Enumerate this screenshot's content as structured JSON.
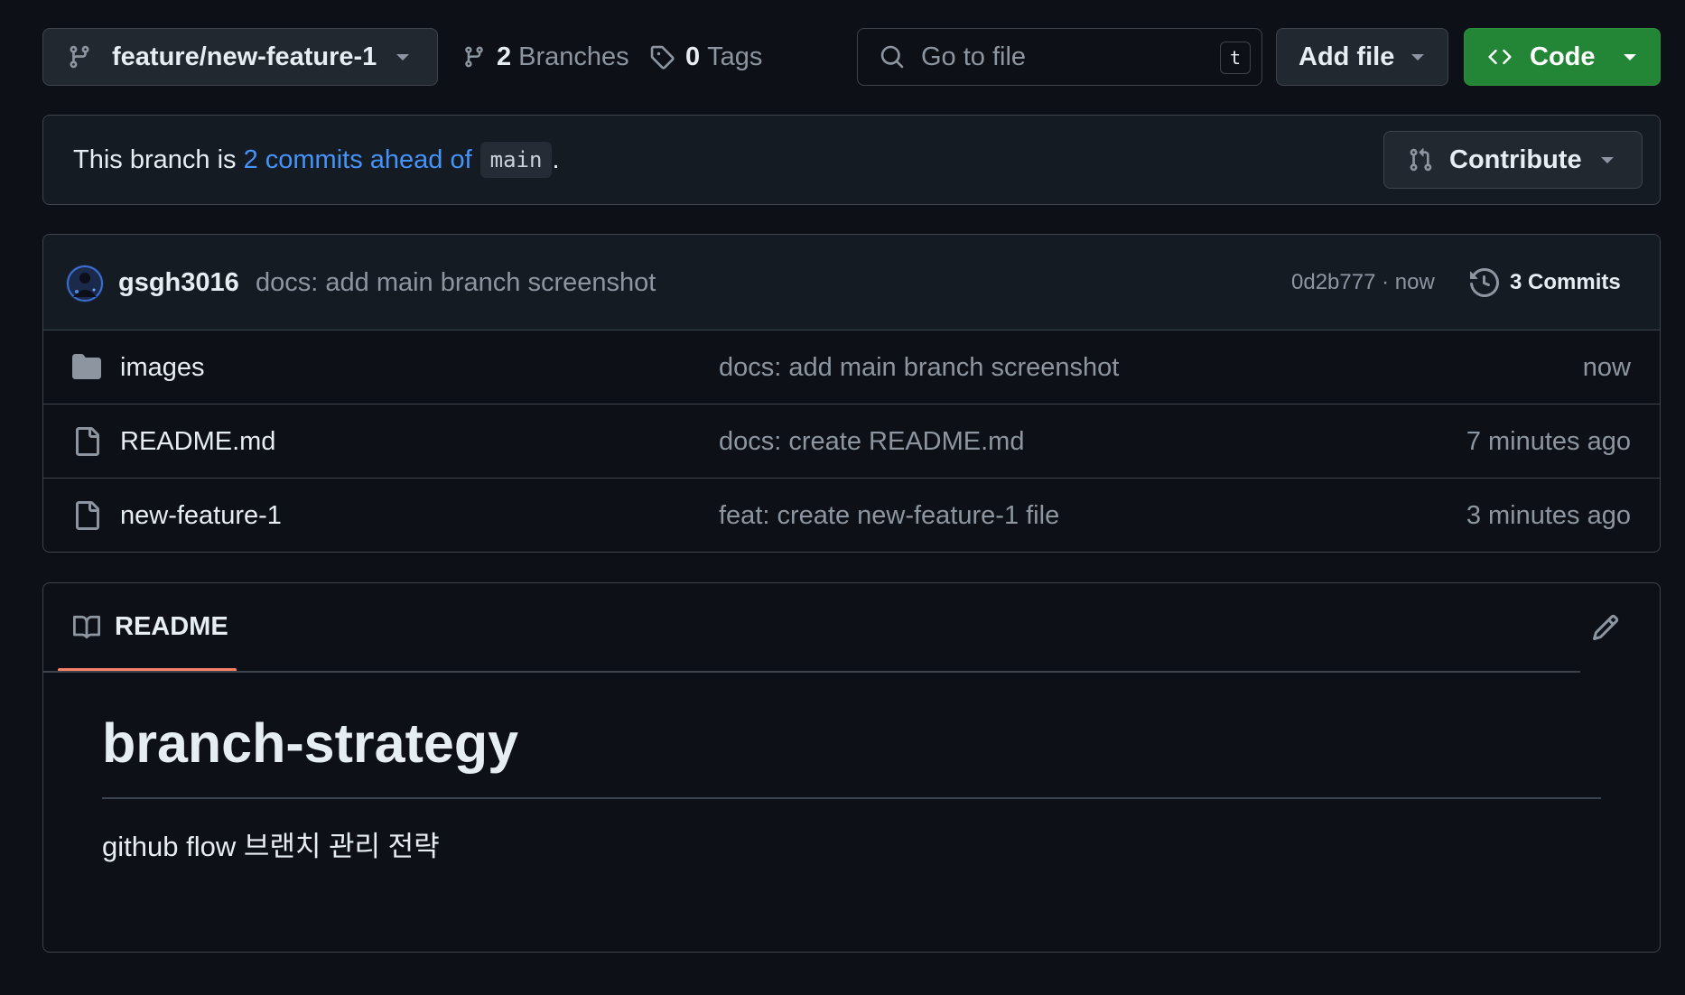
{
  "toolbar": {
    "branch_name": "feature/new-feature-1",
    "branches_count": "2",
    "branches_label": "Branches",
    "tags_count": "0",
    "tags_label": "Tags",
    "search_placeholder": "Go to file",
    "search_shortcut": "t",
    "add_file_label": "Add file",
    "code_label": "Code"
  },
  "banner": {
    "prefix": "This branch is ",
    "link_text": "2 commits ahead of",
    "base_branch": "main",
    "suffix": ".",
    "contribute_label": "Contribute"
  },
  "latest_commit": {
    "author": "gsgh3016",
    "message": "docs: add main branch screenshot",
    "hash_time": "0d2b777 · now",
    "commits_count_label": "3 Commits"
  },
  "files": [
    {
      "type": "folder",
      "icon": "folder-icon",
      "name": "images",
      "message": "docs: add main branch screenshot",
      "time": "now"
    },
    {
      "type": "file",
      "icon": "file-icon",
      "name": "README.md",
      "message": "docs: create README.md",
      "time": "7 minutes ago"
    },
    {
      "type": "file",
      "icon": "file-icon",
      "name": "new-feature-1",
      "message": "feat: create new-feature-1 file",
      "time": "3 minutes ago"
    }
  ],
  "readme": {
    "tab_label": "README",
    "title": "branch-strategy",
    "description": "github flow 브랜치 관리 전략"
  },
  "colors": {
    "background": "#0d1117",
    "border": "#3d444d",
    "link": "#4493f8",
    "code_button": "#238636",
    "tab_accent": "#f78166"
  }
}
